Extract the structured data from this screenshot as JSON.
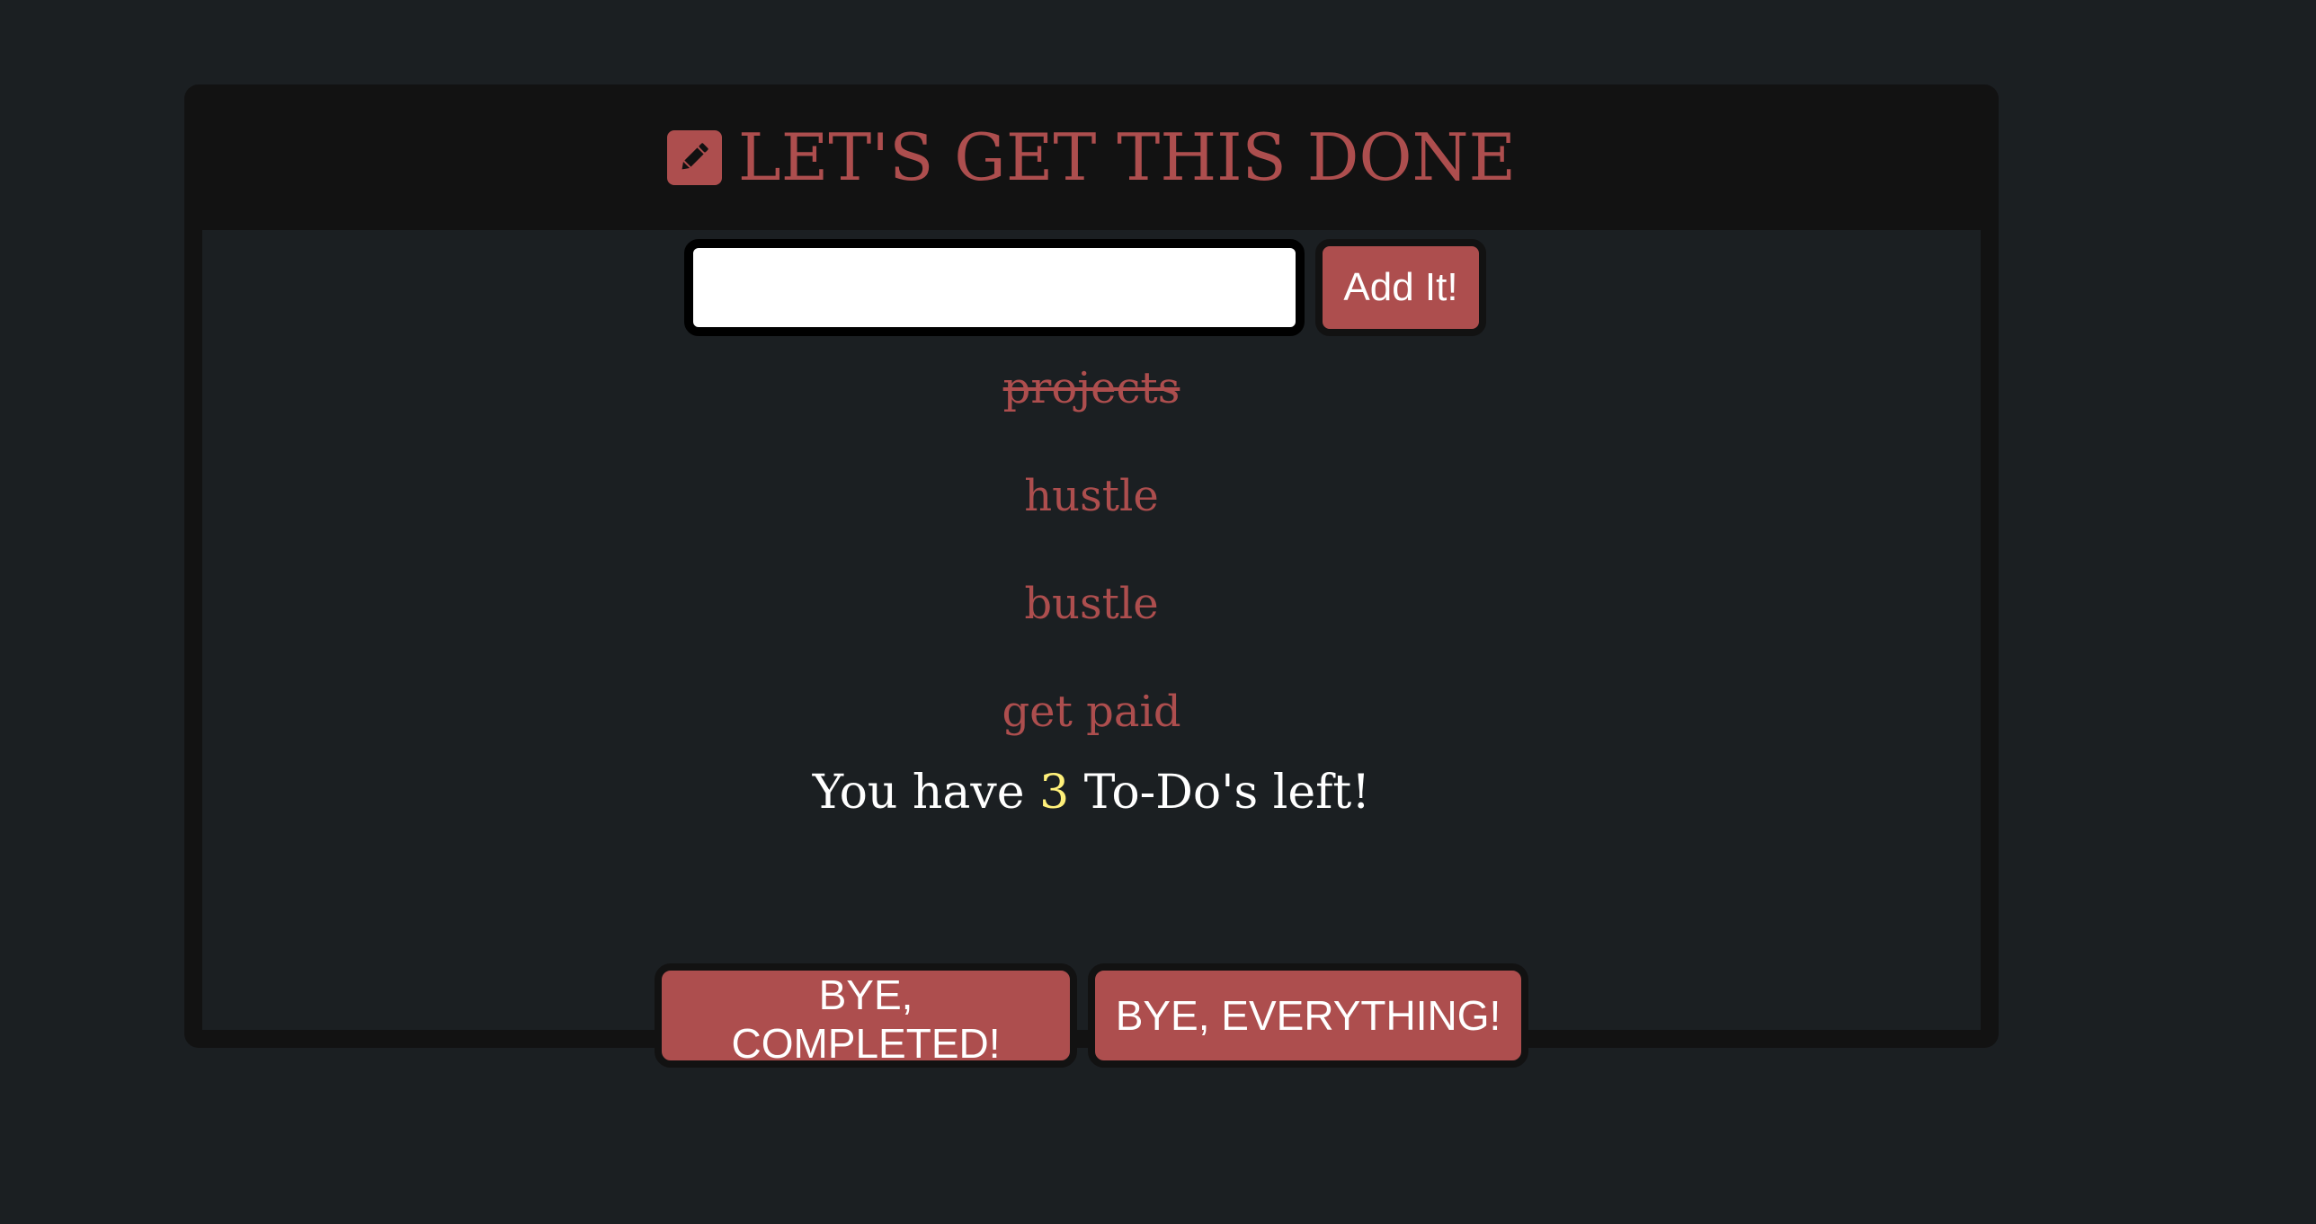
{
  "header": {
    "title": "LET'S GET THIS DONE",
    "icon": "pencil-square-icon"
  },
  "form": {
    "input_value": "",
    "input_placeholder": "",
    "add_label": "Add It!"
  },
  "todos": [
    {
      "text": "projects",
      "completed": true
    },
    {
      "text": "hustle",
      "completed": false
    },
    {
      "text": "bustle",
      "completed": false
    },
    {
      "text": "get paid",
      "completed": false
    }
  ],
  "summary": {
    "prefix": "You have ",
    "count": "3",
    "suffix": " To-Do's left!"
  },
  "actions": {
    "clear_completed_label": "BYE, COMPLETED!",
    "clear_all_label": "BYE, EVERYTHING!"
  },
  "colors": {
    "background": "#1b1f22",
    "card": "#121212",
    "accent": "#ad4e4e",
    "count_highlight": "#fff07a",
    "text": "#ffffff"
  }
}
